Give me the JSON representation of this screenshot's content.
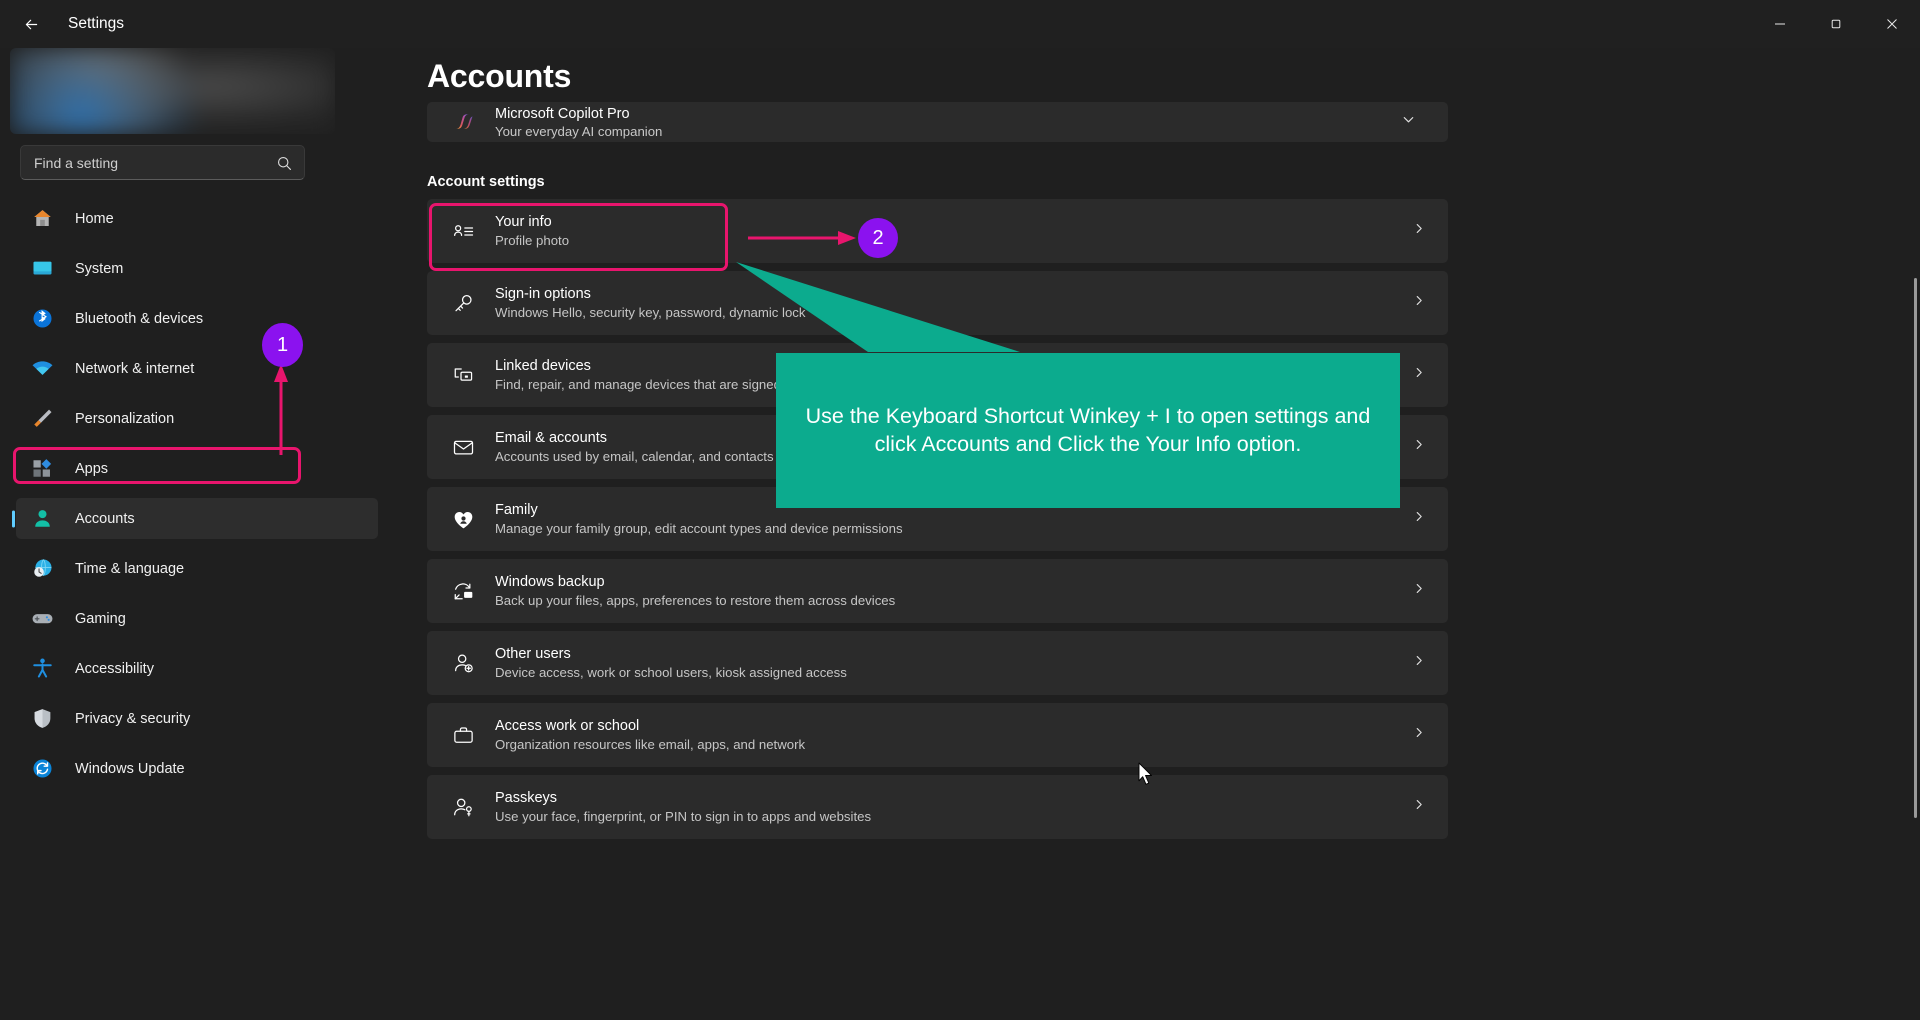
{
  "window": {
    "title": "Settings",
    "back_label": "Back",
    "controls": {
      "minimize": "Minimize",
      "maximize": "Restore",
      "close": "Close"
    }
  },
  "sidebar": {
    "search": {
      "placeholder": "Find a setting",
      "icon": "search-icon"
    },
    "items": [
      {
        "label": "Home",
        "icon": "home-icon",
        "selected": false
      },
      {
        "label": "System",
        "icon": "system-monitor-icon",
        "selected": false
      },
      {
        "label": "Bluetooth & devices",
        "icon": "bluetooth-icon",
        "selected": false
      },
      {
        "label": "Network & internet",
        "icon": "wifi-icon",
        "selected": false
      },
      {
        "label": "Personalization",
        "icon": "paintbrush-icon",
        "selected": false
      },
      {
        "label": "Apps",
        "icon": "apps-icon",
        "selected": false
      },
      {
        "label": "Accounts",
        "icon": "accounts-person-icon",
        "selected": true
      },
      {
        "label": "Time & language",
        "icon": "clock-globe-icon",
        "selected": false
      },
      {
        "label": "Gaming",
        "icon": "gamepad-icon",
        "selected": false
      },
      {
        "label": "Accessibility",
        "icon": "accessibility-person-icon",
        "selected": false
      },
      {
        "label": "Privacy & security",
        "icon": "shield-icon",
        "selected": false
      },
      {
        "label": "Windows Update",
        "icon": "update-refresh-icon",
        "selected": false
      }
    ]
  },
  "main": {
    "page_title": "Accounts",
    "copilot_card": {
      "title": "Microsoft Copilot Pro",
      "subtitle": "Your everyday AI companion",
      "icon": "copilot-icon",
      "chevron": "chevron-down-icon"
    },
    "section_heading": "Account settings",
    "rows": [
      {
        "title": "Your info",
        "subtitle": "Profile photo",
        "icon": "contact-card-icon",
        "chevron": "chevron-right-icon"
      },
      {
        "title": "Sign-in options",
        "subtitle": "Windows Hello, security key, password, dynamic lock",
        "icon": "key-icon",
        "chevron": "chevron-right-icon"
      },
      {
        "title": "Linked devices",
        "subtitle": "Find, repair, and manage devices that are signed in w",
        "icon": "linked-devices-icon",
        "chevron": "chevron-right-icon"
      },
      {
        "title": "Email & accounts",
        "subtitle": "Accounts used by email, calendar, and contacts",
        "icon": "envelope-icon",
        "chevron": "chevron-right-icon"
      },
      {
        "title": "Family",
        "subtitle": "Manage your family group, edit account types and device permissions",
        "icon": "family-heart-icon",
        "chevron": "chevron-right-icon"
      },
      {
        "title": "Windows backup",
        "subtitle": "Back up your files, apps, preferences to restore them across devices",
        "icon": "backup-icon",
        "chevron": "chevron-right-icon"
      },
      {
        "title": "Other users",
        "subtitle": "Device access, work or school users, kiosk assigned access",
        "icon": "add-user-icon",
        "chevron": "chevron-right-icon"
      },
      {
        "title": "Access work or school",
        "subtitle": "Organization resources like email, apps, and network",
        "icon": "briefcase-icon",
        "chevron": "chevron-right-icon"
      },
      {
        "title": "Passkeys",
        "subtitle": "Use your face, fingerprint, or PIN to sign in to apps and websites",
        "icon": "passkey-user-icon",
        "chevron": "chevron-right-icon"
      }
    ]
  },
  "annotations": {
    "badge_1": "1",
    "badge_2": "2",
    "callout_text": "Use the Keyboard Shortcut Winkey + I to open settings and click Accounts and Click the Your Info option.",
    "colors": {
      "highlight": "#e8156d",
      "badge": "#8b12ef",
      "callout": "#0cab8e",
      "arrow": "#e8156d",
      "accent": "#60cdff"
    }
  }
}
